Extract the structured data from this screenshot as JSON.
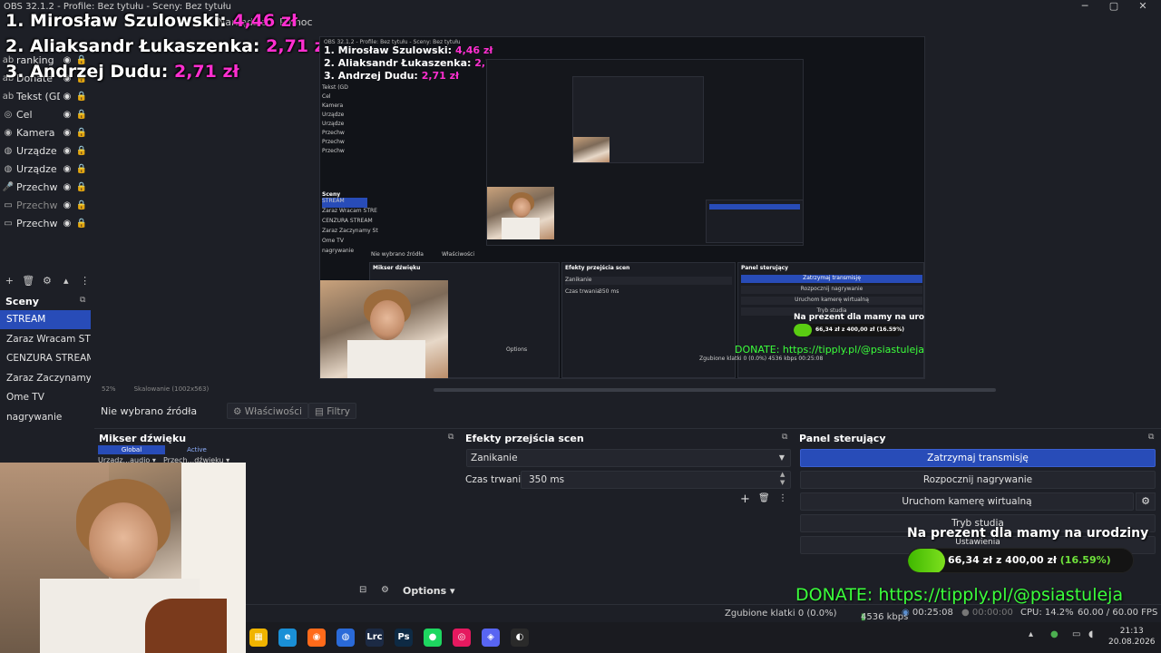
{
  "window": {
    "title": "OBS 32.1.2 - Profile: Bez tytułu - Sceny: Bez tytułu",
    "minimize": "─",
    "maximize": "▢",
    "close": "✕"
  },
  "menubar": {
    "items": [
      "Narzędzia",
      "Pomoc"
    ]
  },
  "overlay_ranking": [
    {
      "place": "1. Mirosław Szulowski:",
      "amount": "4,46 zł"
    },
    {
      "place": "2. Aliaksandr Łukaszenka:",
      "amount": "2,71 zł"
    },
    {
      "place": "3. Andrzej Dudu:",
      "amount": "2,71 zł"
    }
  ],
  "sources": {
    "items": [
      {
        "label": "ranking",
        "icon": "text-icon"
      },
      {
        "label": "Donate",
        "icon": "text-icon"
      },
      {
        "label": "Tekst (GD",
        "icon": "text-icon"
      },
      {
        "label": "Cel",
        "icon": "target-icon"
      },
      {
        "label": "Kamera",
        "icon": "camera-icon"
      },
      {
        "label": "Urządze",
        "icon": "audio-icon"
      },
      {
        "label": "Urządze",
        "icon": "audio-icon"
      },
      {
        "label": "Przechw",
        "icon": "mic-icon"
      },
      {
        "label": "Przechw",
        "icon": "window-icon",
        "dim": true
      },
      {
        "label": "Przechw",
        "icon": "monitor-icon"
      }
    ]
  },
  "scenes": {
    "title": "Sceny",
    "items": [
      "STREAM",
      "Zaraz Wracam STREAM",
      "CENZURA STREAM",
      "Zaraz Zaczynamy STREAM",
      "Ome TV",
      "nagrywanie"
    ],
    "active_index": 0
  },
  "preview": {
    "title": "OBS 32.1.2 - Profile: Bez tytułu - Sceny: Bez tytułu",
    "zoom": "52%",
    "scaling": "Skalowanie (1002x563)",
    "nested": {
      "scenes_title": "Sceny",
      "scenes": [
        "STREAM",
        "Zaraz Wracam STRE",
        "CENZURA STREAM",
        "Zaraz Zaczynamy St",
        "Ome TV",
        "nagrywanie"
      ],
      "sources": [
        "Tekst (GD",
        "Cel",
        "Kamera",
        "Urządze",
        "Urządze",
        "Przechw",
        "Przechw",
        "Przechw"
      ],
      "no_source": "Nie wybrano źródła",
      "properties": "Właściwości",
      "mixer_title": "Mikser dźwięku",
      "transitions_title": "Efekty przejścia scen",
      "transition_value": "Zanikanie",
      "duration_label": "Czas trwania",
      "duration_value": "350 ms",
      "controls_title": "Panel sterujący",
      "ctrl_stop": "Zatrzymaj transmisję",
      "ctrl_record": "Rozpocznij nagrywanie",
      "ctrl_vcam": "Uruchom kamerę wirtualną",
      "ctrl_studio": "Tryb studia",
      "goal_title": "Na prezent dla mamy na urodziny",
      "goal_text": "66,34 zł z 400,00 zł (16.59%)",
      "donate": "DONATE: https://tipply.pl/@psiastuleja",
      "options": "Options",
      "status": "Zgubione klatki 0 (0.0%)  4536 kbps  00:25:08"
    }
  },
  "source_toolbar": {
    "no_source": "Nie wybrano źródła",
    "properties": "Właściwości",
    "filters": "Filtry"
  },
  "mixer": {
    "title": "Mikser dźwięku",
    "tab_global": "Global",
    "tab_active": "Active",
    "device1": "Urządz...audio",
    "device2": "Przech...dźwięku",
    "options": "Options"
  },
  "transitions": {
    "title": "Efekty przejścia scen",
    "selected": "Zanikanie",
    "duration_label": "Czas trwania",
    "duration_value": "350 ms"
  },
  "controls": {
    "title": "Panel sterujący",
    "stop_stream": "Zatrzymaj transmisję",
    "start_recording": "Rozpocznij nagrywanie",
    "virtual_cam": "Uruchom kamerę wirtualną",
    "studio_mode": "Tryb studia",
    "settings": "Ustawienia"
  },
  "goal": {
    "title": "Na prezent dla mamy na urodziny",
    "current": "66,34 zł z 400,00 zł",
    "percent_text": "(16.59%)",
    "fraction": 0.1659,
    "bar_color": "#5acc12"
  },
  "donate": "DONATE: https://tipply.pl/@psiastuleja",
  "status": {
    "dropped": "Zgubione klatki 0 (0.0%)",
    "bitrate": "4536 kbps",
    "live_time": "00:25:08",
    "rec_time": "00:00:00",
    "cpu": "CPU: 14.2%",
    "fps": "60.00 / 60.00 FPS"
  },
  "taskbar": {
    "apps": [
      {
        "name": "file-explorer-icon",
        "glyph": "▦",
        "color": "#f0b400"
      },
      {
        "name": "edge-icon",
        "glyph": "e",
        "color": "#1a8fd6"
      },
      {
        "name": "firefox-icon",
        "glyph": "◉",
        "color": "#ff6a1a"
      },
      {
        "name": "browser-icon",
        "glyph": "◍",
        "color": "#2a6ad8"
      },
      {
        "name": "lrc-icon",
        "glyph": "Lrc",
        "color": "#1c2a44"
      },
      {
        "name": "photoshop-icon",
        "glyph": "Ps",
        "color": "#0e2a44"
      },
      {
        "name": "spotify-icon",
        "glyph": "●",
        "color": "#1ed760"
      },
      {
        "name": "music-icon",
        "glyph": "◎",
        "color": "#e5195f"
      },
      {
        "name": "discord-icon",
        "glyph": "◈",
        "color": "#5865f2"
      },
      {
        "name": "obs-icon",
        "glyph": "◐",
        "color": "#2a2a2a"
      }
    ],
    "time": "21:13",
    "date": "20.08.2026"
  }
}
